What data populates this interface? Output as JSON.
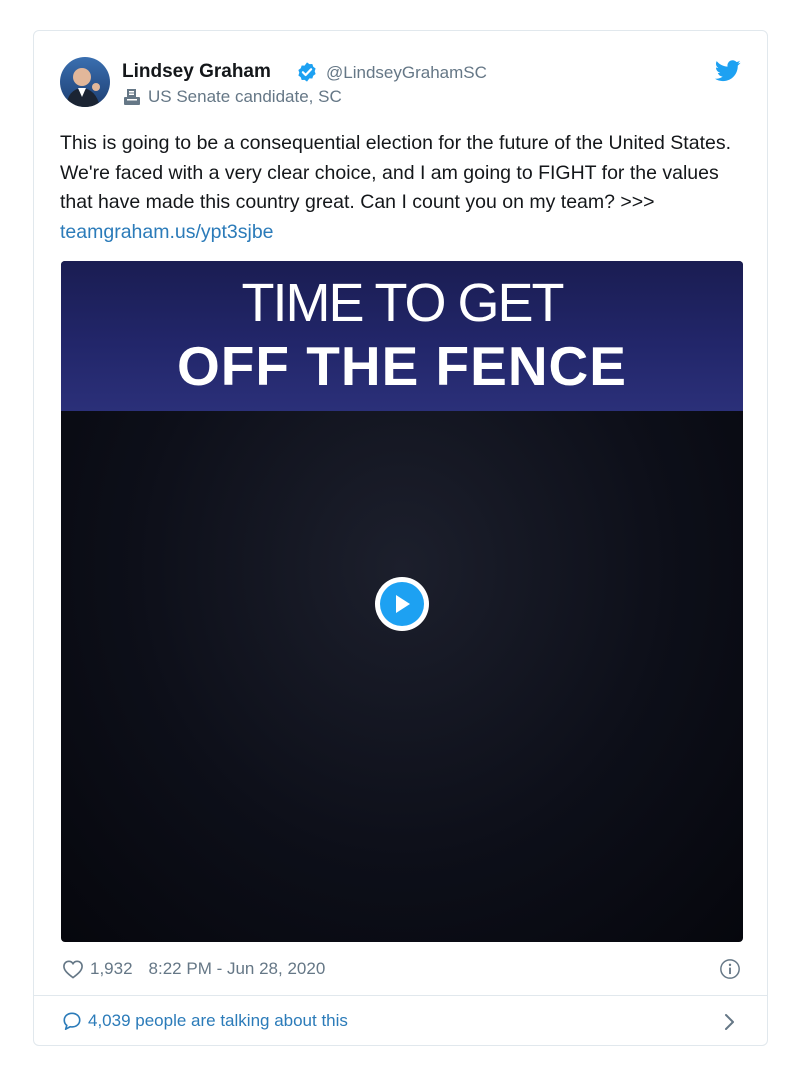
{
  "author": {
    "name": "Lindsey Graham",
    "handle": "@LindseyGrahamSC",
    "label": "US Senate candidate, SC"
  },
  "tweet": {
    "text": "This is going to be a consequential election for the future of the United States. We're faced with a very clear choice, and I am going to FIGHT for the values that have made this country great. Can I count you on my team? >>> ",
    "link": "teamgraham.us/ypt3sjbe"
  },
  "media": {
    "line1": "TIME TO GET",
    "line2": "OFF THE FENCE"
  },
  "stats": {
    "likes": "1,932",
    "timestamp": "8:22 PM - Jun 28, 2020",
    "talking": "4,039 people are talking about this"
  },
  "icons": {
    "verified": "verified-badge-icon",
    "label": "ballot-box-icon",
    "brand": "twitter-bird-icon",
    "like": "heart-icon",
    "info": "info-icon",
    "reply": "speech-bubble-icon",
    "more": "chevron-right-icon"
  },
  "colors": {
    "accent": "#1da1f2",
    "link": "#2b7bb9",
    "muted": "#657786",
    "banner": "#22266a"
  }
}
